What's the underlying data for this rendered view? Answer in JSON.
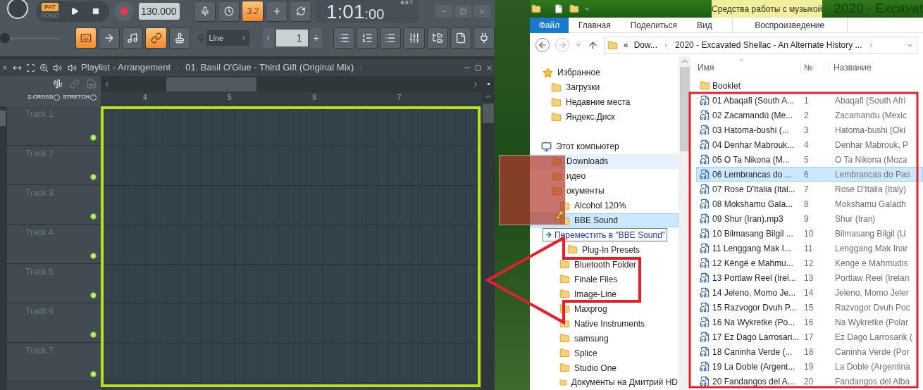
{
  "fl_toolbar": {
    "mode": [
      {
        "label": "PAT",
        "selected": true
      },
      {
        "label": "SONG",
        "selected": false
      }
    ],
    "master": {
      "level": 0
    },
    "tempo": "130.000",
    "signature_button": {
      "label": "3.2",
      "on": true
    },
    "time": {
      "main": "1:01",
      "sub": ":00",
      "format": "B:S:T"
    },
    "tools": [
      {
        "on": true
      },
      {
        "on": false
      },
      {
        "on": false
      },
      {
        "on": true
      },
      {
        "on": false
      }
    ],
    "snap": "Line",
    "step": "1",
    "step_plus": "+"
  },
  "playlist": {
    "title": "Playlist - Arrangement",
    "pattern": "01. Basil O'Glue - Third Gift (Original Mix)",
    "options": [
      {
        "label": "Z-CROSS",
        "checked": false
      },
      {
        "label": "STRETCH",
        "checked": false
      }
    ],
    "ruler": [
      "4",
      "5",
      "6",
      "7"
    ],
    "tracks": [
      {
        "name": "Track 1",
        "enabled": true
      },
      {
        "name": "Track 2",
        "enabled": true
      },
      {
        "name": "Track 3",
        "enabled": true
      },
      {
        "name": "Track 4",
        "enabled": true
      },
      {
        "name": "Track 5",
        "enabled": true
      },
      {
        "name": "Track 6",
        "enabled": true
      },
      {
        "name": "Track 7",
        "enabled": true
      }
    ]
  },
  "explorer": {
    "context_tab": "Средства работы с музыкой",
    "title": "2020 - Excavat",
    "tabs": [
      {
        "label": "Файл",
        "kind": "file"
      },
      {
        "label": "Главная",
        "kind": "tab"
      },
      {
        "label": "Поделиться",
        "kind": "tab"
      },
      {
        "label": "Вид",
        "kind": "tab"
      },
      {
        "label": "Воспроизведение",
        "kind": "context"
      }
    ],
    "address": [
      "«",
      "Dow...",
      "2020 - Excavated Shellac - An Alternate History ..."
    ],
    "favorites": {
      "label": "Избранное",
      "items": [
        "Загрузки",
        "Недавние места",
        "Яндекс.Диск"
      ]
    },
    "computer": {
      "label": "Этот компьютер",
      "children": [
        {
          "label": "Downloads",
          "hovered": true,
          "selected": false
        },
        {
          "label": "идео",
          "hovered": false,
          "selected": false
        },
        {
          "label": "окументы",
          "hovered": false,
          "selected": false,
          "children": [
            {
              "label": "Alcohol 120%",
              "hovered": false,
              "selected": false
            },
            {
              "label": "BBE Sound",
              "hovered": false,
              "selected": true,
              "children": [
                {
                  "label": "Plug-In Presets",
                  "hovered": false,
                  "selected": false
                }
              ]
            },
            {
              "label": "Bluetooth Folder",
              "hovered": false,
              "selected": false
            },
            {
              "label": "Finale Files",
              "hovered": false,
              "selected": false
            },
            {
              "label": "Image-Line",
              "hovered": false,
              "selected": false
            },
            {
              "label": "Maxprog",
              "hovered": false,
              "selected": false
            },
            {
              "label": "Native Instruments",
              "hovered": false,
              "selected": false
            },
            {
              "label": "samsung",
              "hovered": false,
              "selected": false
            },
            {
              "label": "Splice",
              "hovered": false,
              "selected": false
            },
            {
              "label": "Studio One",
              "hovered": false,
              "selected": false
            },
            {
              "label": "Документы на Дмитрий HD",
              "hovered": false,
              "selected": false
            }
          ]
        }
      ]
    },
    "drag_tooltip": "Переместить в \"BBE Sound\"",
    "columns": [
      "Имя",
      "№",
      "Название"
    ],
    "rows": [
      {
        "kind": "folder",
        "name": "Booklet",
        "selected": false
      },
      {
        "kind": "audio",
        "name": "01 Abaqafi (South A...",
        "number": "1",
        "title": "Abaqafi (South Afri",
        "selected": false
      },
      {
        "kind": "audio",
        "name": "02 Zacamandú (Me...",
        "number": "2",
        "title": "Zacamandu (Mexic",
        "selected": false
      },
      {
        "kind": "audio",
        "name": "03 Hatoma-bushi (...",
        "number": "3",
        "title": "Hatoma-bushi (Oki",
        "selected": false
      },
      {
        "kind": "audio",
        "name": "04 Denhar Mabrouk...",
        "number": "4",
        "title": "Denhar Mabrouk, P",
        "selected": false
      },
      {
        "kind": "audio",
        "name": "05 O Ta Nikona (M...",
        "number": "5",
        "title": "O Ta Nikona (Moza",
        "selected": false
      },
      {
        "kind": "audio",
        "name": "06 Lembrancas do ...",
        "number": "6",
        "title": "Lembrancas do Pas",
        "selected": true
      },
      {
        "kind": "audio",
        "name": "07 Rose D'Italia (Ital...",
        "number": "7",
        "title": "Rose D'Italia (Italy)",
        "selected": false
      },
      {
        "kind": "audio",
        "name": "08 Mokshamu Gala...",
        "number": "8",
        "title": "Mokshamu Galadh",
        "selected": false
      },
      {
        "kind": "audio",
        "name": "09 Shur (Iran).mp3",
        "number": "9",
        "title": "Shur (Iran)",
        "selected": false
      },
      {
        "kind": "audio",
        "name": "10 Bilmasang Bilgil ...",
        "number": "10",
        "title": "Bilmasang Bilgil (U",
        "selected": false
      },
      {
        "kind": "audio",
        "name": "11 Lenggang Mak I...",
        "number": "11",
        "title": "Lenggang Mak Inar",
        "selected": false
      },
      {
        "kind": "audio",
        "name": "12 Këngë e Mahmu...",
        "number": "12",
        "title": "Kenge e Mahmudis",
        "selected": false
      },
      {
        "kind": "audio",
        "name": "13 Portlaw Reel (Irel...",
        "number": "13",
        "title": "Portlaw Reel (Irelan",
        "selected": false
      },
      {
        "kind": "audio",
        "name": "14 Jeleno, Momo Je...",
        "number": "14",
        "title": "Jeleno, Momo Jeler",
        "selected": false
      },
      {
        "kind": "audio",
        "name": "15 Razvogor Dvuh P...",
        "number": "15",
        "title": "Razvogor Dvuh Poc",
        "selected": false
      },
      {
        "kind": "audio",
        "name": "16 Na Wykretke (Po...",
        "number": "16",
        "title": "Na Wykretke (Polar",
        "selected": false
      },
      {
        "kind": "audio",
        "name": "17 Ez Dago Larrosari...",
        "number": "17",
        "title": "Ez Dago Larrosarik (",
        "selected": false
      },
      {
        "kind": "audio",
        "name": "18 Caninha Verde (...",
        "number": "18",
        "title": "Caninha Verde (Por",
        "selected": false
      },
      {
        "kind": "audio",
        "name": "19 La Doble (Argent...",
        "number": "19",
        "title": "La Doble (Argentina",
        "selected": false
      },
      {
        "kind": "audio",
        "name": "20 Fandangos del A...",
        "number": "20",
        "title": "Fandangos del Alba",
        "selected": false
      }
    ]
  }
}
